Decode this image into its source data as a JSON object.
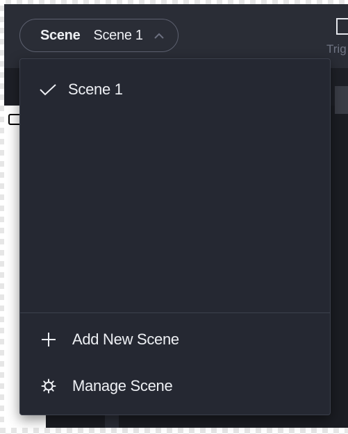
{
  "scene_selector": {
    "label": "Scene",
    "current_value": "Scene 1",
    "chevron_icon": "chevron-up-icon"
  },
  "trigger_tool": {
    "label": "Trig",
    "icon": "trigger-icon"
  },
  "dropdown": {
    "scenes": [
      {
        "label": "Scene 1",
        "selected": true,
        "icon": "check-icon"
      }
    ],
    "actions": [
      {
        "label": "Add New Scene",
        "icon": "plus-icon"
      },
      {
        "label": "Manage Scene",
        "icon": "gear-icon"
      }
    ]
  },
  "colors": {
    "menu_background": "#252832",
    "text": "#eef0f4",
    "pill_border": "#5d6170",
    "muted_text": "#707584"
  }
}
